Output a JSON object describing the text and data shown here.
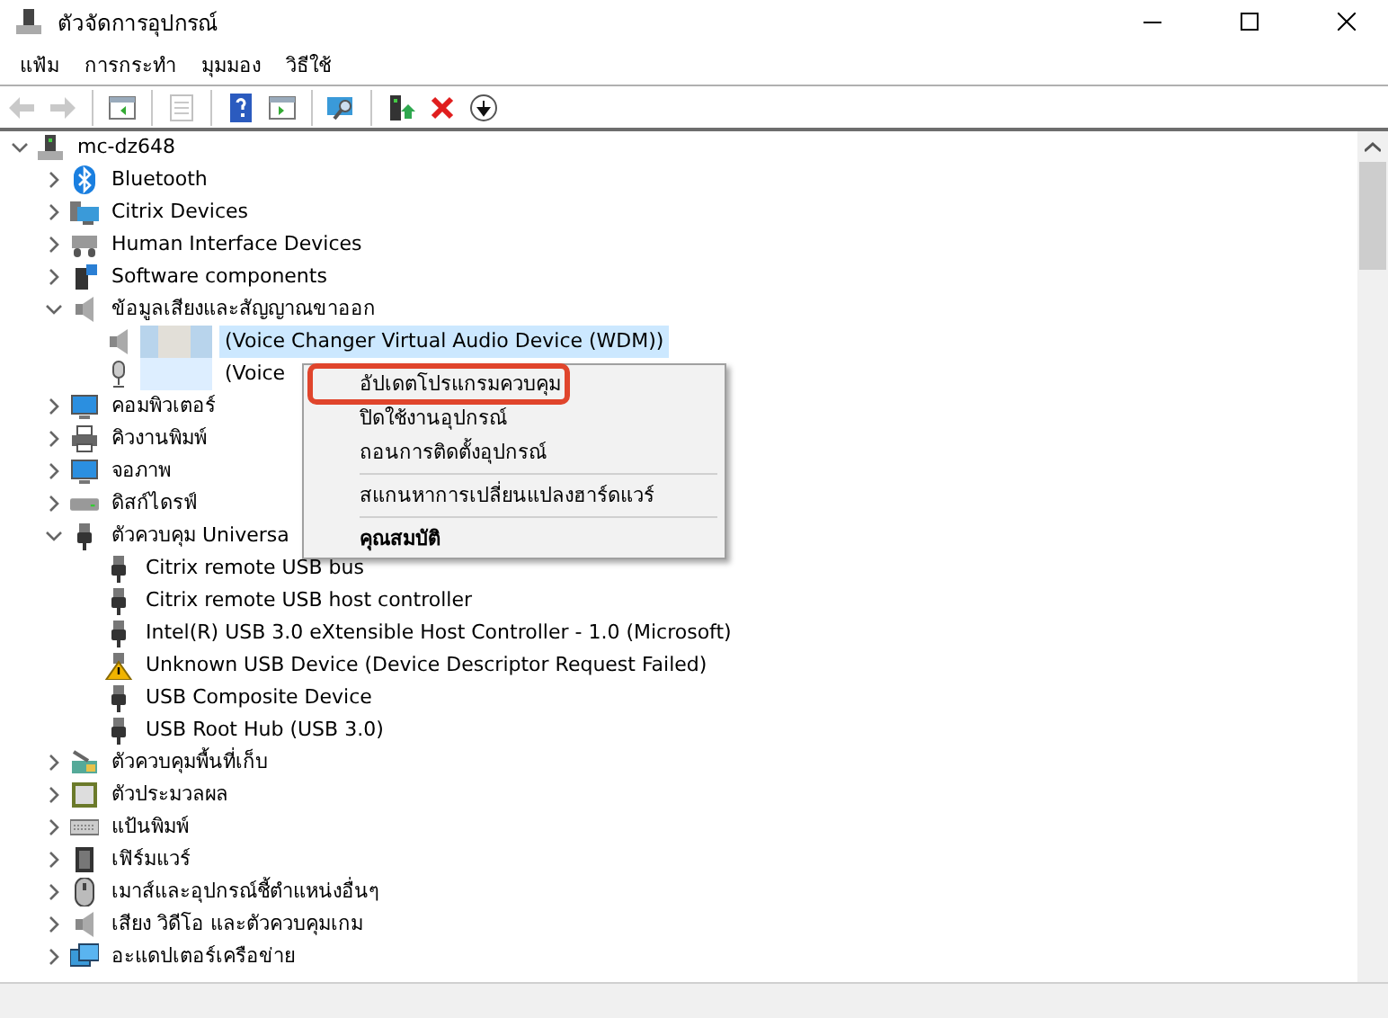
{
  "window": {
    "title": "ตัวจัดการอุปกรณ์"
  },
  "menu_bar": [
    {
      "label": "แฟ้ม"
    },
    {
      "label": "การกระทำ"
    },
    {
      "label": "มุมมอง"
    },
    {
      "label": "วิธีใช้"
    }
  ],
  "toolbar": [
    {
      "kind": "back",
      "disabled": true
    },
    {
      "kind": "forward",
      "disabled": true
    },
    {
      "kind": "separator"
    },
    {
      "kind": "pane",
      "disabled": false
    },
    {
      "kind": "separator"
    },
    {
      "kind": "properties",
      "disabled": true
    },
    {
      "kind": "separator"
    },
    {
      "kind": "help",
      "disabled": false
    },
    {
      "kind": "action-pane",
      "disabled": false
    },
    {
      "kind": "separator"
    },
    {
      "kind": "scan",
      "disabled": false
    },
    {
      "kind": "separator"
    },
    {
      "kind": "update",
      "disabled": false
    },
    {
      "kind": "uninstall",
      "disabled": false
    },
    {
      "kind": "disable",
      "disabled": false
    }
  ],
  "tree": [
    {
      "label": "mc-dz648",
      "kind": "computer",
      "expanded": true,
      "selected": false,
      "children": [
        {
          "label": "Bluetooth",
          "kind": "bluetooth",
          "expanded": false,
          "selected": false
        },
        {
          "label": "Citrix Devices",
          "kind": "citrix",
          "expanded": false,
          "selected": false
        },
        {
          "label": "Human Interface Devices",
          "kind": "hid",
          "expanded": false,
          "selected": false
        },
        {
          "label": "Software components",
          "kind": "software",
          "expanded": false,
          "selected": false
        },
        {
          "label": "ข้อมูลเสียงและสัญญาณขาออก",
          "kind": "speaker",
          "expanded": true,
          "selected": false,
          "children": [
            {
              "label": "(Voice Changer Virtual Audio Device (WDM))",
              "kind": "speaker",
              "redacted": true,
              "selected": true
            },
            {
              "label": "(Voice",
              "kind": "mic",
              "redacted": true,
              "selected": false
            }
          ]
        },
        {
          "label": "คอมพิวเตอร์",
          "kind": "monitor",
          "expanded": false,
          "selected": false
        },
        {
          "label": "คิวงานพิมพ์",
          "kind": "printer",
          "expanded": false,
          "selected": false
        },
        {
          "label": "จอภาพ",
          "kind": "monitor",
          "expanded": false,
          "selected": false
        },
        {
          "label": "ดิสก์ไดรฟ์",
          "kind": "disk",
          "expanded": false,
          "selected": false
        },
        {
          "label": "ตัวควบคุม Universa",
          "kind": "usb",
          "expanded": true,
          "selected": false,
          "children": [
            {
              "label": "Citrix remote USB bus",
              "kind": "usb",
              "selected": false
            },
            {
              "label": "Citrix remote USB host controller",
              "kind": "usb",
              "selected": false
            },
            {
              "label": "Intel(R) USB 3.0 eXtensible Host Controller - 1.0 (Microsoft)",
              "kind": "usb",
              "selected": false
            },
            {
              "label": "Unknown USB Device (Device Descriptor Request Failed)",
              "kind": "usb-warning",
              "selected": false
            },
            {
              "label": "USB Composite Device",
              "kind": "usb",
              "selected": false
            },
            {
              "label": "USB Root Hub (USB 3.0)",
              "kind": "usb",
              "selected": false
            }
          ]
        },
        {
          "label": "ตัวควบคุมพื้นที่เก็บ",
          "kind": "storage",
          "expanded": false,
          "selected": false
        },
        {
          "label": "ตัวประมวลผล",
          "kind": "processor",
          "expanded": false,
          "selected": false
        },
        {
          "label": "แป้นพิมพ์",
          "kind": "keyboard",
          "expanded": false,
          "selected": false
        },
        {
          "label": "เฟิร์มแวร์",
          "kind": "chip",
          "expanded": false,
          "selected": false
        },
        {
          "label": "เมาส์และอุปกรณ์ชี้ตำแหน่งอื่นๆ",
          "kind": "mouse",
          "expanded": false,
          "selected": false
        },
        {
          "label": "เสียง วิดีโอ และตัวควบคุมเกม",
          "kind": "speaker",
          "expanded": false,
          "selected": false
        },
        {
          "label": "อะแดปเตอร์เครือข่าย",
          "kind": "network",
          "expanded": false,
          "selected": false
        }
      ]
    }
  ],
  "context_menu": [
    {
      "label": "อัปเดตโปรแกรมควบคุม",
      "annotated": true,
      "default": false,
      "separator_before": false
    },
    {
      "label": "ปิดใช้งานอุปกรณ์",
      "annotated": false,
      "default": false,
      "separator_before": false
    },
    {
      "label": "ถอนการติดตั้งอุปกรณ์",
      "annotated": false,
      "default": false,
      "separator_before": false
    },
    {
      "label": "สแกนหาการเปลี่ยนแปลงฮาร์ดแวร์",
      "annotated": false,
      "default": false,
      "separator_before": true
    },
    {
      "label": "คุณสมบัติ",
      "annotated": false,
      "default": true,
      "separator_before": true
    }
  ]
}
